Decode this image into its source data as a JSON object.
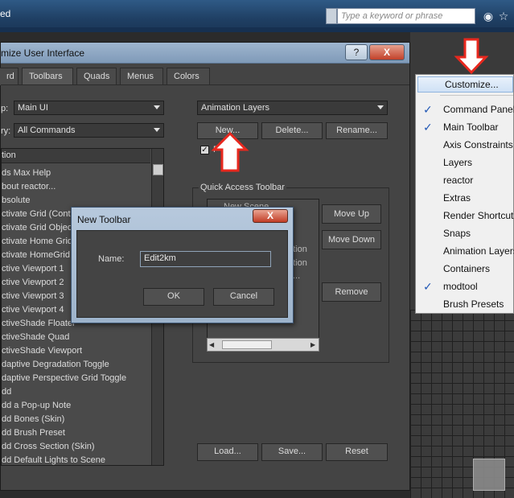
{
  "app_bar": {
    "title_fragment": "ed",
    "search_placeholder": "Type a keyword or phrase"
  },
  "customize_dialog": {
    "title": "mize User Interface",
    "help_btn": "?",
    "close_btn": "X",
    "tabs": [
      "rd",
      "Toolbars",
      "Quads",
      "Menus",
      "Colors"
    ],
    "group_label": "p:",
    "group_value": "Main UI",
    "category_label": "ry:",
    "category_value": "All Commands",
    "toolbar_select_value": "Animation Layers",
    "new_btn": "New...",
    "delete_btn": "Delete...",
    "rename_btn": "Rename...",
    "checkbox_label": "F",
    "list_header": "tion",
    "actions": [
      "ds Max Help",
      "bout reactor...",
      "bsolute",
      "ctivate Grid (Conte",
      "ctivate Grid Object",
      "ctivate Home Grid",
      "ctivate HomeGrid (",
      "ctive Viewport 1",
      "ctive Viewport 2",
      "ctive Viewport 3",
      "ctive Viewport 4",
      "ctiveShade Floater",
      "ctiveShade Quad",
      "ctiveShade Viewport",
      "daptive Degradation Toggle",
      "daptive Perspective Grid Toggle",
      "dd",
      "dd a Pop-up Note",
      "dd Bones (Skin)",
      "dd Brush Preset",
      "dd Cross Section (Skin)",
      "dd Default Lights to Scene"
    ],
    "qat_label": "Quick Access Toolbar",
    "qat_items": [
      "New Scene",
      "ation",
      "ation",
      "..."
    ],
    "move_up_btn": "Move Up",
    "move_down_btn": "Move Down",
    "remove_btn": "Remove",
    "load_btn": "Load...",
    "save_btn": "Save...",
    "reset_btn": "Reset"
  },
  "new_toolbar_dialog": {
    "title": "New Toolbar",
    "close_btn": "X",
    "name_label": "Name:",
    "name_value": "Edit2km",
    "ok_btn": "OK",
    "cancel_btn": "Cancel"
  },
  "dropdown_menu": {
    "customize": "Customize...",
    "items": [
      {
        "label": "Command Panel",
        "checked": true
      },
      {
        "label": "Main Toolbar",
        "checked": true
      },
      {
        "label": "Axis Constraints",
        "checked": false
      },
      {
        "label": "Layers",
        "checked": false
      },
      {
        "label": "reactor",
        "checked": false
      },
      {
        "label": "Extras",
        "checked": false
      },
      {
        "label": "Render Shortcuts",
        "checked": false
      },
      {
        "label": "Snaps",
        "checked": false
      },
      {
        "label": "Animation Layers",
        "checked": false
      },
      {
        "label": "Containers",
        "checked": false
      },
      {
        "label": "modtool",
        "checked": true
      },
      {
        "label": "Brush Presets",
        "checked": false
      }
    ]
  },
  "colors": {
    "callout_red": "#e8281e",
    "checkmark_blue": "#1f56b5"
  }
}
